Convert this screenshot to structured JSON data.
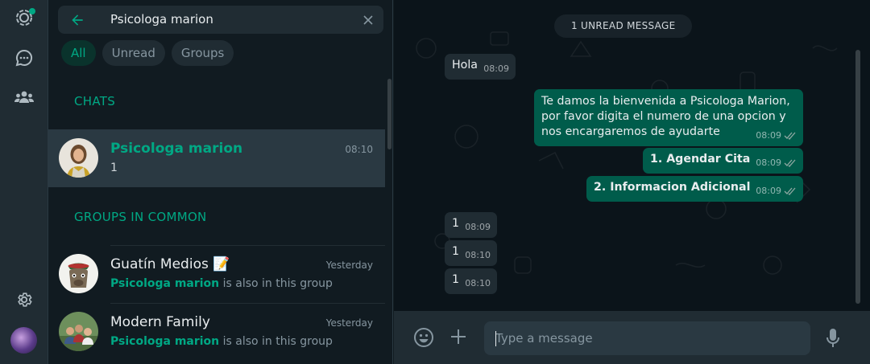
{
  "colors": {
    "accent": "#00a884",
    "sidebar_bg": "#111b21",
    "panel_bg": "#202c33",
    "outgoing_bubble": "#005c4b",
    "incoming_bubble": "#202c33"
  },
  "rail": {
    "icons": [
      "status-icon",
      "channels-icon",
      "communities-icon",
      "settings-icon"
    ]
  },
  "search": {
    "query": "Psicologa marion"
  },
  "filters": [
    "All",
    "Unread",
    "Groups"
  ],
  "sections": {
    "chats": "CHATS",
    "groups": "GROUPS IN COMMON"
  },
  "chats": [
    {
      "name": "Psicologa marion",
      "time": "08:10",
      "preview": "1"
    }
  ],
  "groups": [
    {
      "name": "Guatín Medios 📝",
      "time": "Yesterday",
      "member": "Psicologa marion",
      "suffix": " is also in this group"
    },
    {
      "name": "Modern Family",
      "time": "Yesterday",
      "member": "Psicologa marion",
      "suffix": " is also in this group"
    }
  ],
  "conversation": {
    "unread_label": "1 UNREAD MESSAGE",
    "messages": [
      {
        "dir": "in",
        "text": "Hola",
        "time": "08:09"
      },
      {
        "dir": "out",
        "text": "Te damos la bienvenida a Psicologa Marion, por favor digita el numero de una opcion y nos encargaremos de ayudarte",
        "time": "08:09"
      },
      {
        "dir": "out",
        "text": "1. Agendar Cita",
        "time": "08:09"
      },
      {
        "dir": "out",
        "text": "2. Informacion Adicional",
        "time": "08:09"
      },
      {
        "dir": "in",
        "text": "1",
        "time": "08:09"
      },
      {
        "dir": "in",
        "text": "1",
        "time": "08:10"
      },
      {
        "dir": "in",
        "text": "1",
        "time": "08:10"
      }
    ]
  },
  "composer": {
    "placeholder": "Type a message"
  }
}
